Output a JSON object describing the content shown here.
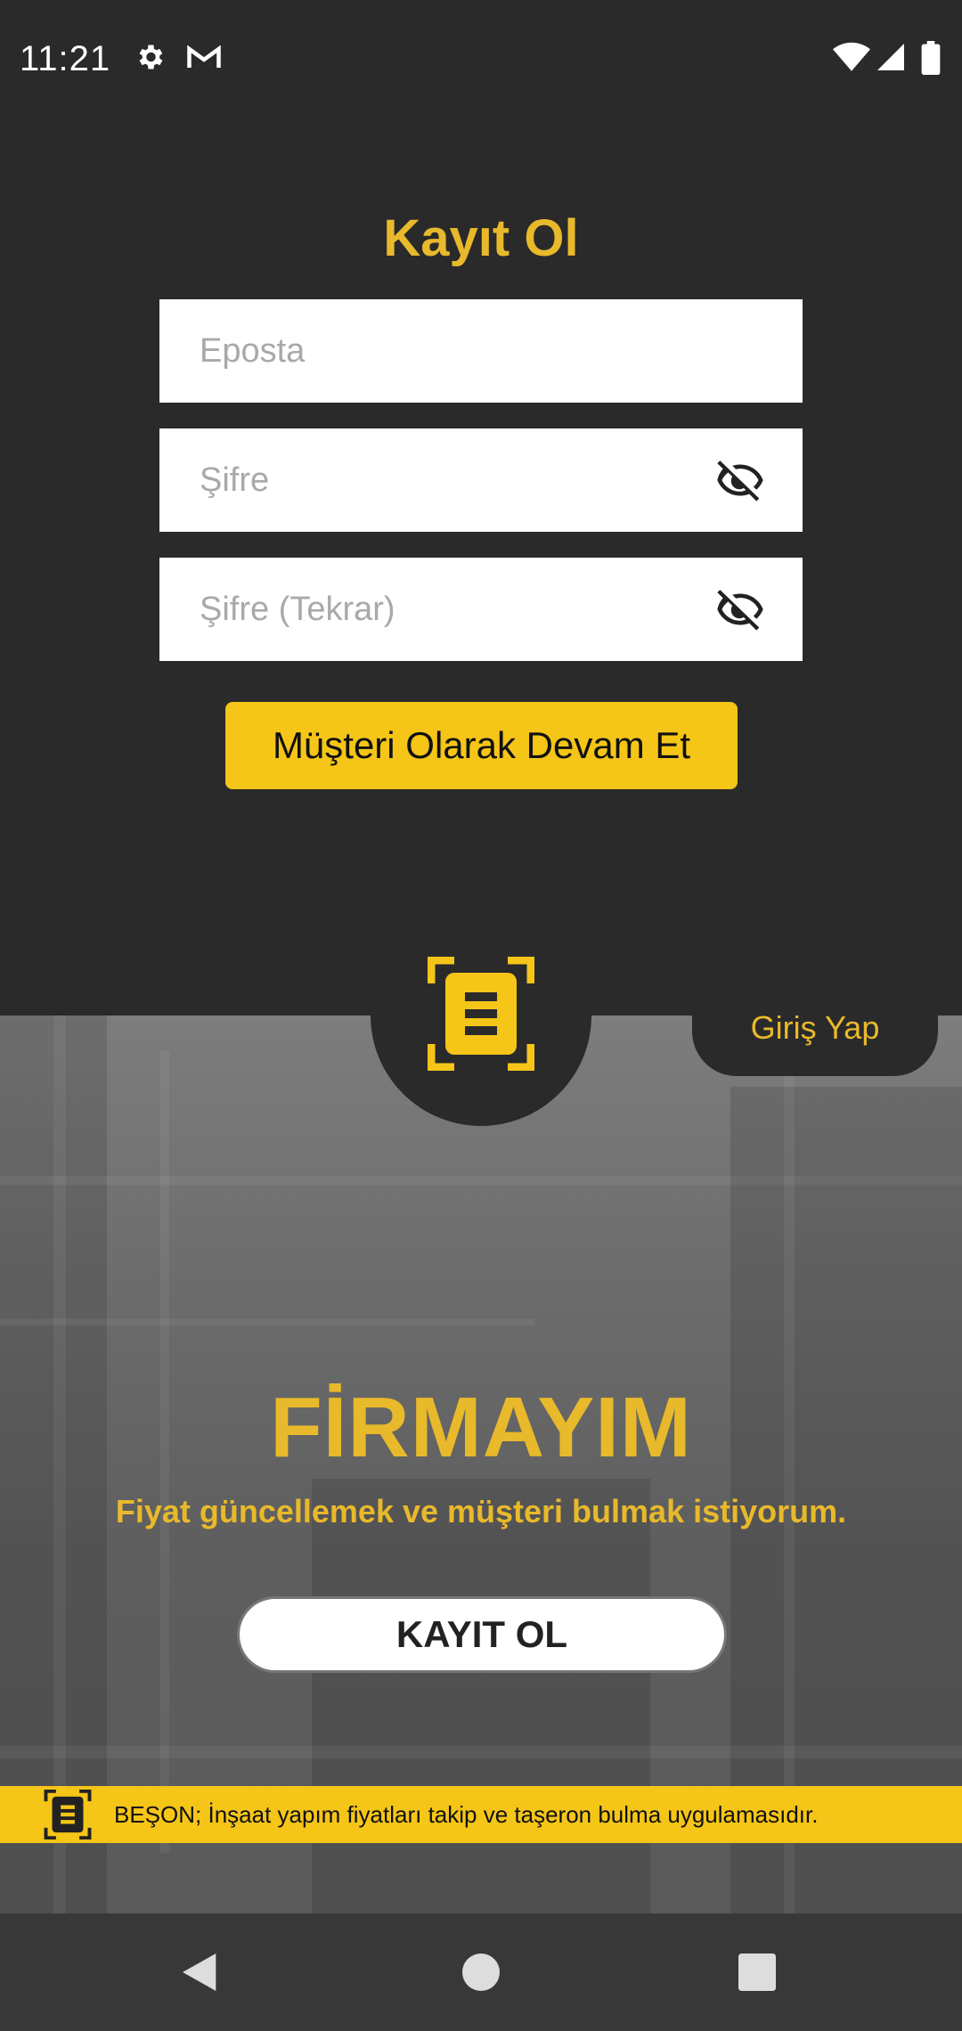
{
  "status_bar": {
    "time": "11:21",
    "icons": [
      "settings-icon",
      "gmail-icon",
      "wifi-icon",
      "signal-icon",
      "battery-icon"
    ]
  },
  "register": {
    "title": "Kayıt Ol",
    "email_placeholder": "Eposta",
    "password_placeholder": "Şifre",
    "password_repeat_placeholder": "Şifre (Tekrar)",
    "continue_button": "Müşteri Olarak Devam Et"
  },
  "login": {
    "label": "Giriş Yap"
  },
  "firm": {
    "title": "FİRMAYIM",
    "subtitle": "Fiyat güncellemek ve müşteri bulmak istiyorum.",
    "register_button": "KAYIT OL"
  },
  "banner": {
    "text": "BEŞON; İnşaat yapım fiyatları takip ve taşeron bulma uygulamasıdır."
  },
  "colors": {
    "background": "#2a2a2b",
    "accent": "#f5c518",
    "accent_text": "#e8b92b"
  },
  "navigation": [
    "back-icon",
    "home-icon",
    "recents-icon"
  ]
}
